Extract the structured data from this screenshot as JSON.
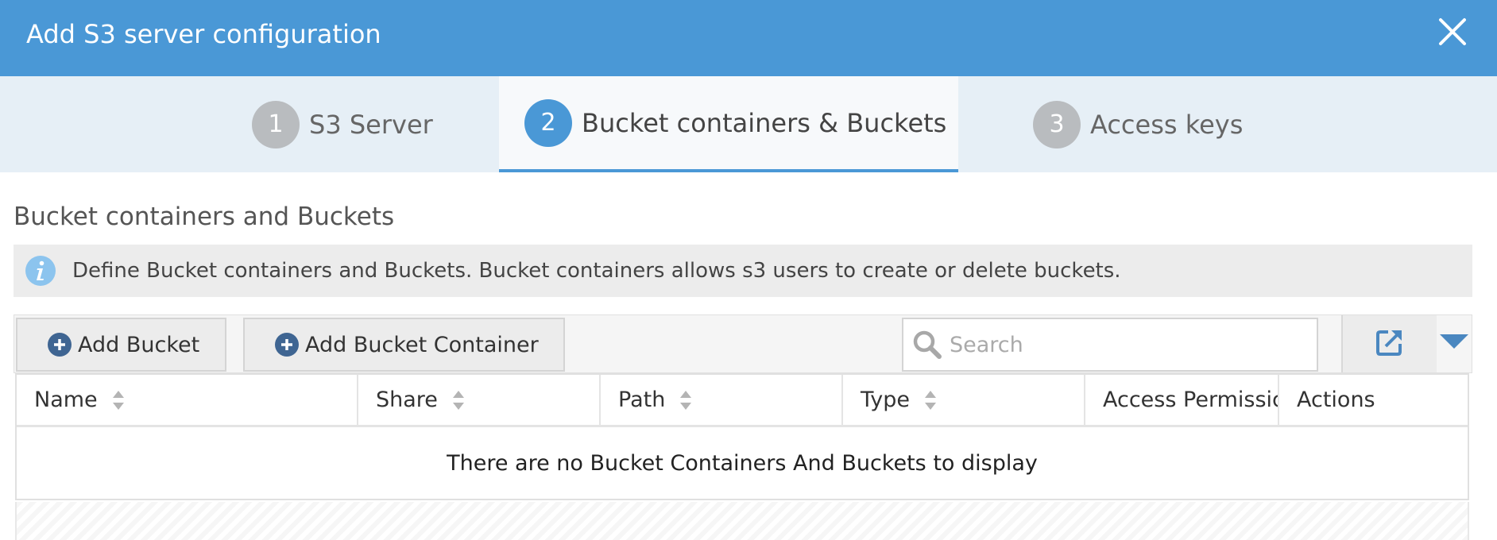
{
  "dialog": {
    "title": "Add S3 server configuration"
  },
  "steps": [
    {
      "number": "1",
      "label": "S3 Server"
    },
    {
      "number": "2",
      "label": "Bucket containers & Buckets"
    },
    {
      "number": "3",
      "label": "Access keys"
    }
  ],
  "section": {
    "title": "Bucket containers and Buckets",
    "info": "Define Bucket containers and Buckets. Bucket containers allows s3 users to create or delete buckets."
  },
  "toolbar": {
    "add_bucket_label": "Add Bucket",
    "add_container_label": "Add Bucket Container",
    "search_placeholder": "Search"
  },
  "table": {
    "columns": [
      "Name",
      "Share",
      "Path",
      "Type",
      "Access Permissic",
      "Actions"
    ],
    "empty_message": "There are no Bucket Containers And Buckets to display"
  },
  "colors": {
    "accent": "#4a98d6",
    "step_inactive": "#b9bcbf",
    "button_icon": "#3f6592"
  }
}
